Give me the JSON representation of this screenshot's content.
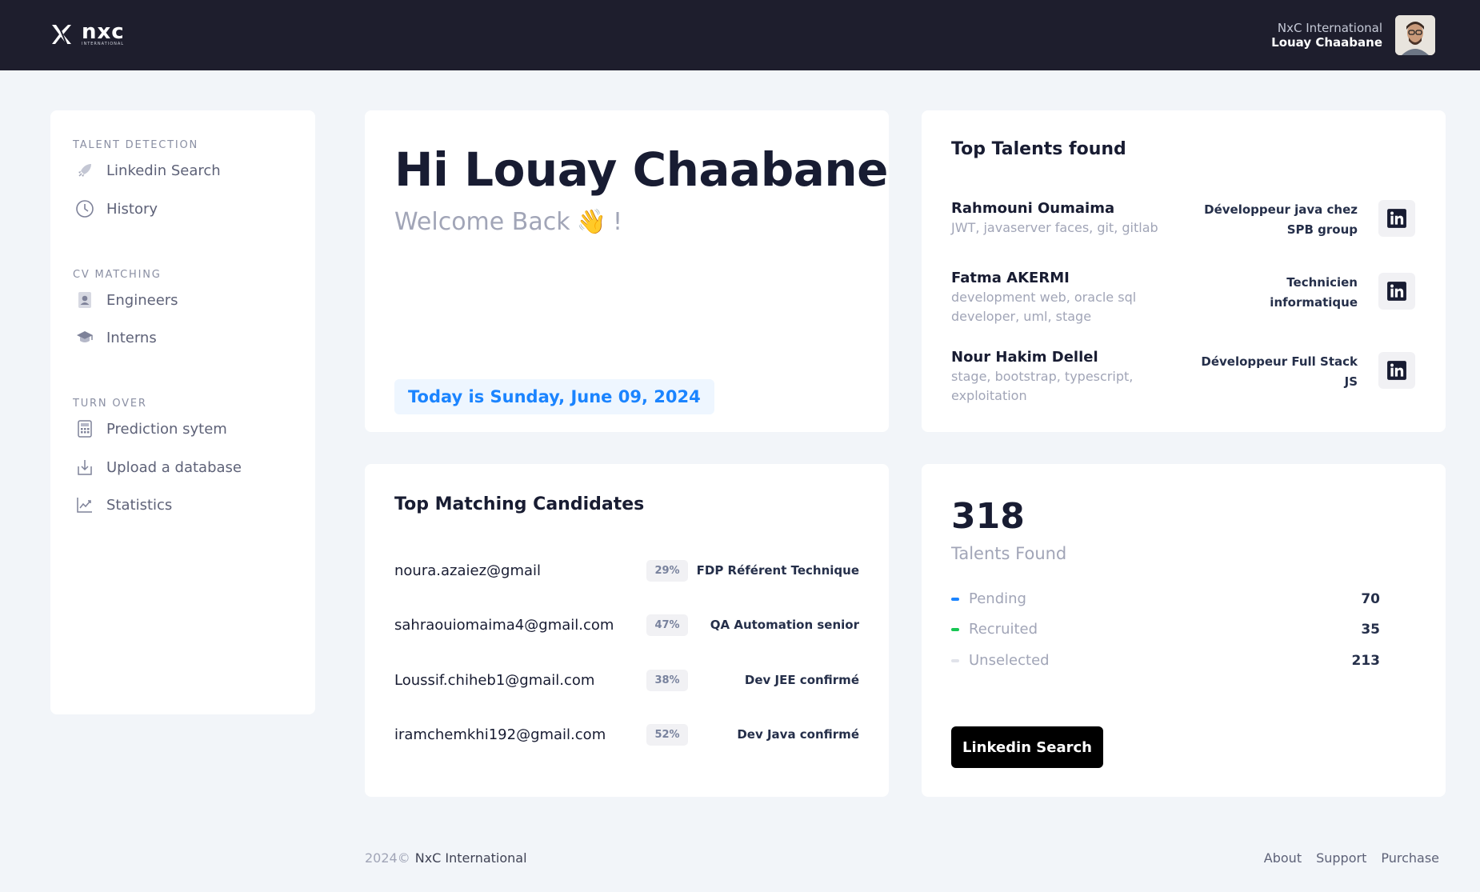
{
  "header": {
    "logo_text": "nxc",
    "logo_sub": "INTERNATIONAL",
    "company": "NxC International",
    "user_name": "Louay Chaabane"
  },
  "sidebar": {
    "sections": [
      {
        "title": "TALENT DETECTION",
        "items": [
          {
            "label": "Linkedin Search",
            "icon": "rocket-icon"
          },
          {
            "label": "History",
            "icon": "clock-icon"
          }
        ]
      },
      {
        "title": "CV MATCHING",
        "items": [
          {
            "label": "Engineers",
            "icon": "profile-document-icon"
          },
          {
            "label": "Interns",
            "icon": "graduation-cap-icon"
          }
        ]
      },
      {
        "title": "TURN OVER",
        "items": [
          {
            "label": "Prediction sytem",
            "icon": "calculator-icon"
          },
          {
            "label": "Upload a database",
            "icon": "download-icon"
          },
          {
            "label": "Statistics",
            "icon": "chart-line-icon"
          }
        ]
      }
    ]
  },
  "hero": {
    "title": "Hi Louay Chaabane",
    "subtitle": "Welcome Back",
    "emoji": "👋",
    "exclaim": "!",
    "date": "Today is Sunday, June 09, 2024"
  },
  "talents": {
    "title": "Top Talents found",
    "items": [
      {
        "name": "Rahmouni Oumaima",
        "skills": "JWT, javaserver faces, git, gitlab",
        "role": "Développeur java chez SPB group"
      },
      {
        "name": "Fatma AKERMI",
        "skills": "development web, oracle sql developer, uml, stage",
        "role": "Technicien informatique"
      },
      {
        "name": "Nour Hakim Dellel",
        "skills": "stage, bootstrap, typescript, exploitation",
        "role": "Développeur Full Stack JS"
      }
    ]
  },
  "matching": {
    "title": "Top Matching Candidates",
    "rows": [
      {
        "email": "noura.azaiez@gmail",
        "pct": "29%",
        "role": "FDP Référent Technique"
      },
      {
        "email": "sahraouiomaima4@gmail.com",
        "pct": "47%",
        "role": "QA Automation senior"
      },
      {
        "email": "Loussif.chiheb1@gmail.com",
        "pct": "38%",
        "role": "Dev JEE confirmé"
      },
      {
        "email": "iramchemkhi192@gmail.com",
        "pct": "52%",
        "role": "Dev Java confirmé"
      }
    ]
  },
  "stats": {
    "total": "318",
    "label": "Talents Found",
    "legend": [
      {
        "label": "Pending",
        "value": "70",
        "color": "#1b84ff"
      },
      {
        "label": "Recruited",
        "value": "35",
        "color": "#17c653"
      },
      {
        "label": "Unselected",
        "value": "213",
        "color": "#e1e3ea"
      }
    ],
    "button": "Linkedin Search"
  },
  "footer": {
    "year": "2024©",
    "company": "NxC International",
    "links": [
      "About",
      "Support",
      "Purchase"
    ]
  }
}
